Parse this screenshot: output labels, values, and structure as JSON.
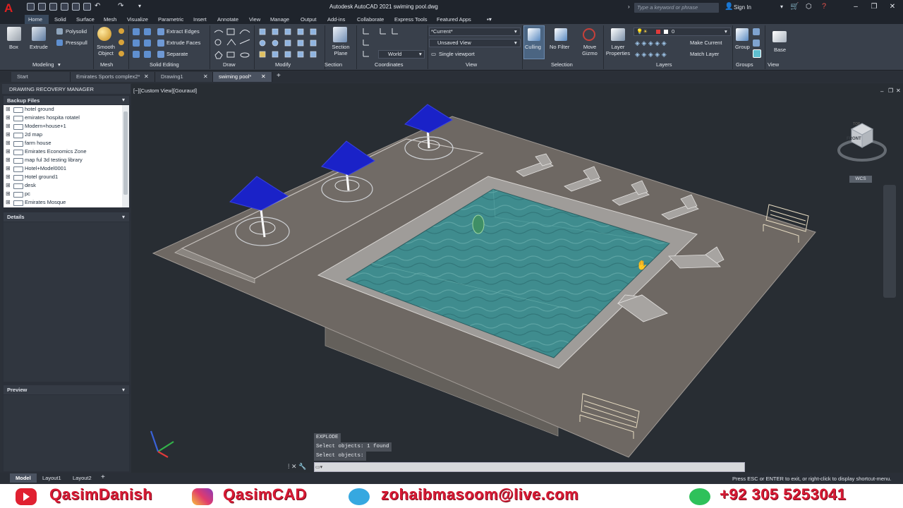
{
  "app": {
    "title": "Autodesk AutoCAD 2021    swiming pool.dwg",
    "logo_letter": "A",
    "search_placeholder": "Type a keyword or phrase",
    "sign_in": "Sign In"
  },
  "ribbon_tabs": [
    "Home",
    "Solid",
    "Surface",
    "Mesh",
    "Visualize",
    "Parametric",
    "Insert",
    "Annotate",
    "View",
    "Manage",
    "Output",
    "Add-ins",
    "Collaborate",
    "Express Tools",
    "Featured Apps"
  ],
  "ribbon": {
    "box": "Box",
    "extrude": "Extrude",
    "polysolid": "Polysolid",
    "presspull": "Presspull",
    "smooth_object": "Smooth Object",
    "extract_edges": "Extract Edges",
    "extrude_faces": "Extrude Faces",
    "separate": "Separate",
    "section_plane": "Section Plane",
    "world": "World",
    "current": "*Current*",
    "unsaved_view": "Unsaved View",
    "single_viewport": "Single viewport",
    "culling": "Culling",
    "no_filter": "No Filter",
    "move_gizmo": "Move Gizmo",
    "layer_properties": "Layer Properties",
    "layer_current": "0",
    "make_current": "Make Current",
    "match_layer": "Match Layer",
    "group": "Group",
    "base": "Base"
  },
  "panels": [
    "Modeling",
    "Mesh",
    "Solid Editing",
    "Draw",
    "Modify",
    "Section",
    "Coordinates",
    "View",
    "Selection",
    "Layers",
    "Groups",
    "View"
  ],
  "doc_tabs": [
    "Start",
    "Emirates Sports complex2*",
    "Drawing1",
    "swiming pool*"
  ],
  "recovery": {
    "title": "DRAWING RECOVERY MANAGER",
    "backup_files": "Backup Files",
    "files": [
      "hotel ground",
      "emirates hospita rotatel",
      "Modern+house+1",
      "2d map",
      "farm house",
      "Emirates Economics Zone",
      "map ful 3d testing library",
      "Hotel+Model0001",
      "Hotel ground1",
      "desk",
      "pc",
      "Emirates Mosque"
    ],
    "details": "Details",
    "preview": "Preview"
  },
  "viewport": {
    "label": "[−][Custom View][Gouraud]",
    "wcs": "WCS",
    "cube_face": "FRONT",
    "cube_top": "TOP"
  },
  "command": {
    "history": [
      "EXPLODE",
      "Select objects: 1 found",
      "Select objects:"
    ]
  },
  "status": {
    "tabs": [
      "Model",
      "Layout1",
      "Layout2"
    ],
    "message": "Press ESC or ENTER to exit, or right-click to display shortcut-menu."
  },
  "banner": {
    "youtube": "QasimDanish",
    "instagram": "QasimCAD",
    "email": "zohaibmasoom@live.com",
    "phone": "+92 305 5253041"
  },
  "colors": {
    "pool_water": "#3f8c8e",
    "deck": "#6e6863",
    "umbrella": "#1a22c8",
    "banner_text": "#d81a34"
  }
}
